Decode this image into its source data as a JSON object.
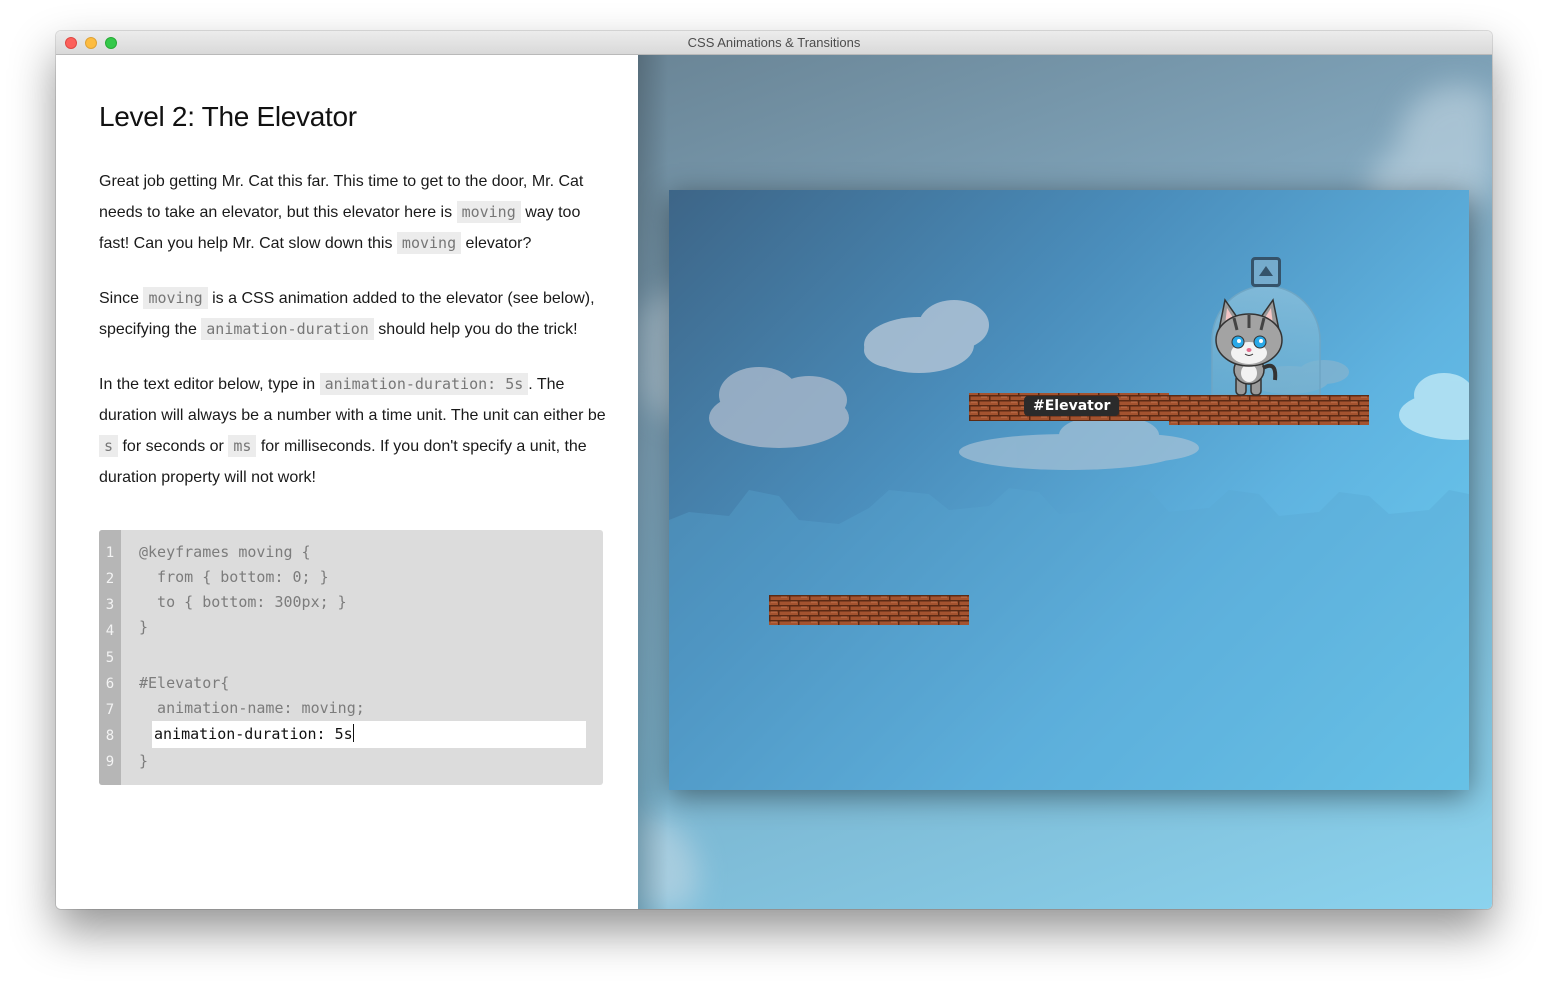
{
  "window": {
    "title": "CSS Animations & Transitions"
  },
  "lesson": {
    "title": "Level 2: The Elevator",
    "p1": {
      "t1": "Great job getting Mr. Cat this far. This time to get to the door, Mr. Cat needs to take an elevator, but this elevator here is ",
      "c1": "moving",
      "t2": " way too fast! Can you help Mr. Cat slow down this ",
      "c2": "moving",
      "t3": " elevator?"
    },
    "p2": {
      "t1": "Since ",
      "c1": "moving",
      "t2": " is a CSS animation added to the elevator (see below), specifying the ",
      "c2": "animation-duration",
      "t3": " should help you do the trick!"
    },
    "p3": {
      "t1": "In the text editor below, type in ",
      "c1": "animation-duration: 5s",
      "t2": ". The duration will always be a number with a time unit. The unit can either be ",
      "c2": "s",
      "t3": " for seconds or ",
      "c3": "ms",
      "t4": " for milliseconds. If you don't specify a unit, the duration property will not work!"
    }
  },
  "editor": {
    "line_numbers": [
      "1",
      "2",
      "3",
      "4",
      "5",
      "6",
      "7",
      "8",
      "9"
    ],
    "lines": [
      "@keyframes moving {",
      "  from { bottom: 0; }",
      "  to { bottom: 300px; }",
      "}",
      "",
      "#Elevator{",
      "  animation-name: moving;",
      "",
      "}"
    ],
    "input_value": "animation-duration: 5s"
  },
  "game": {
    "elevator_label": "#Elevator",
    "door_icon": "up-arrow-icon",
    "character": "cat"
  },
  "colors": {
    "code_bg": "#ececec",
    "editor_bg": "#dcdcdc",
    "gutter_bg": "#b6b6b6",
    "brick": "#a4532f",
    "label_bg": "#2b2b2b"
  }
}
